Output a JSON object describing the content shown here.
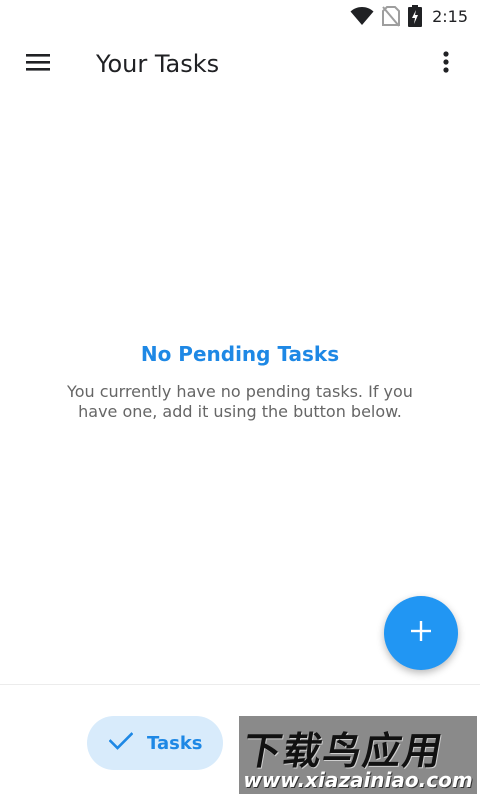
{
  "status_bar": {
    "time": "2:15",
    "icons": [
      "wifi-icon",
      "no-sim-icon",
      "battery-charging-icon"
    ]
  },
  "app_bar": {
    "title": "Your Tasks",
    "icons": [
      "menu-icon",
      "more-vert-icon"
    ]
  },
  "empty_state": {
    "title": "No Pending Tasks",
    "message": "You currently have no pending tasks. If you have one, add it using the button below."
  },
  "fab": {
    "icon": "plus-icon",
    "color": "#2196f3"
  },
  "bottom_nav": {
    "items": [
      {
        "label": "Tasks",
        "icon": "check-icon",
        "selected": true
      }
    ]
  },
  "colors": {
    "accent": "#1e88e5",
    "selected_pill": "#d8ebfb"
  },
  "watermark": {
    "line1": "下载鸟应用",
    "line2": "www.xiazainiao.com"
  }
}
